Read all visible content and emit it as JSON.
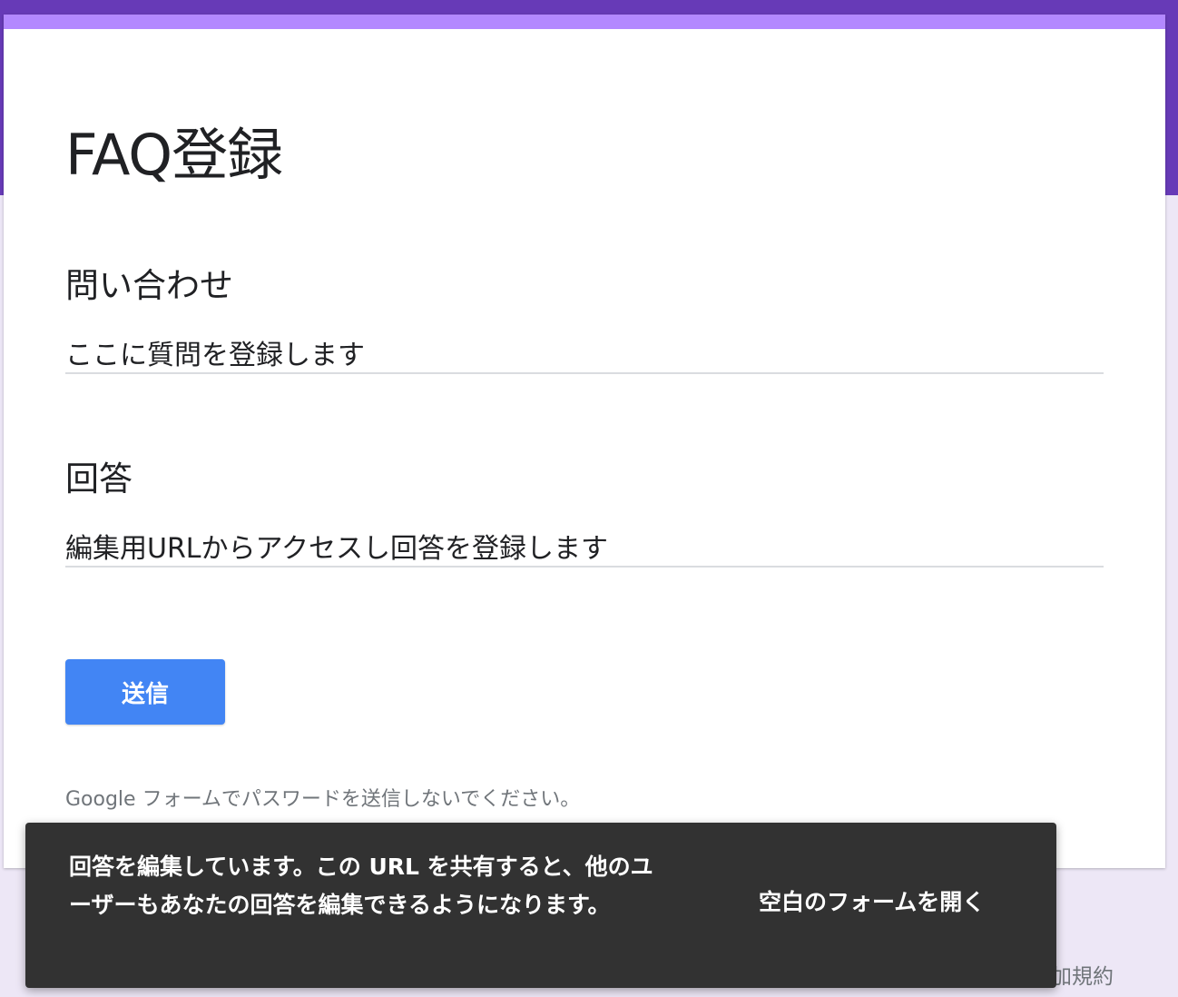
{
  "colors": {
    "header_band": "#673ab7",
    "card_accent": "#b388ff",
    "page_background": "#ede7f6",
    "submit_button": "#4285f4",
    "toast_background": "#323232"
  },
  "form": {
    "title": "FAQ登録",
    "questions": [
      {
        "label": "問い合わせ",
        "value": "ここに質問を登録します"
      },
      {
        "label": "回答",
        "value": "編集用URLからアクセスし回答を登録します"
      }
    ],
    "submit_label": "送信",
    "disclaimer": "Google フォームでパスワードを送信しないでください。"
  },
  "footer": {
    "terms_label": "加規約"
  },
  "snackbar": {
    "message": "回答を編集しています。この URL を共有すると、他のユーザーもあなたの回答を編集できるようになります。",
    "action_label": "空白のフォームを開く"
  }
}
